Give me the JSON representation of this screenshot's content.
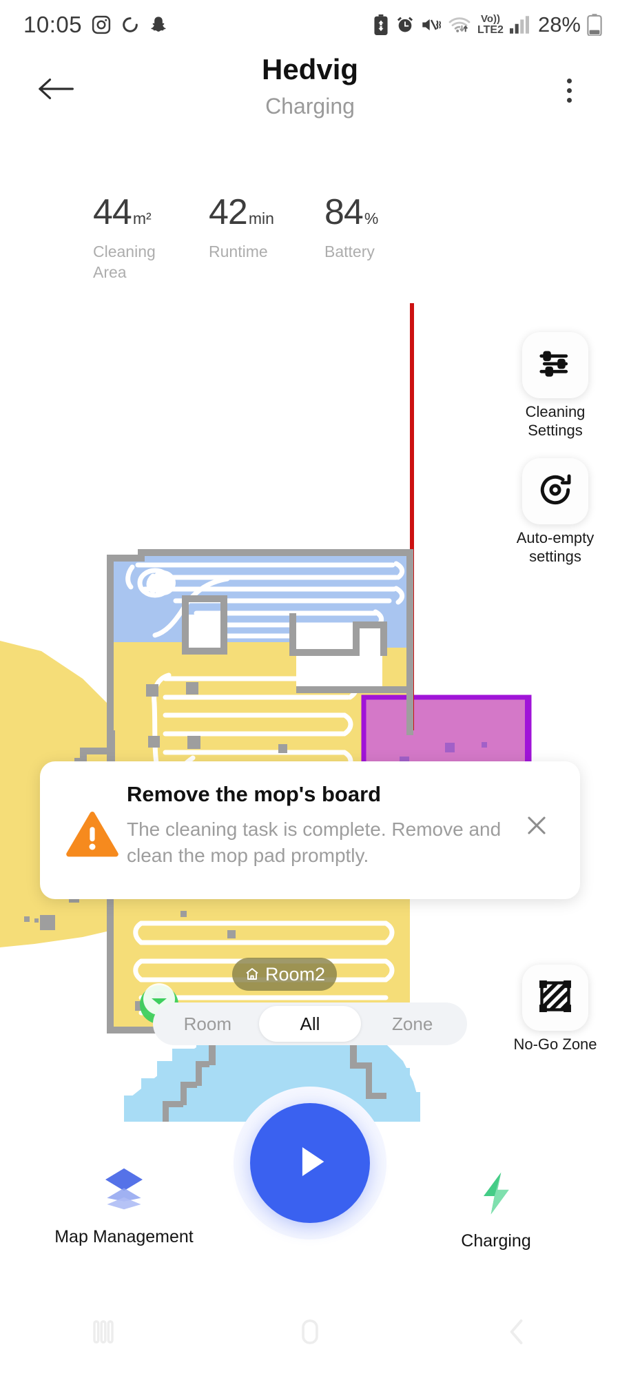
{
  "status_bar": {
    "time": "10:05",
    "left_icons": [
      "instagram-icon",
      "sync-icon",
      "snapchat-icon"
    ],
    "right_icons": [
      "battery-saver-icon",
      "alarm-icon",
      "mute-vibrate-icon",
      "wifi-icon",
      "volte-icon",
      "signal-icon"
    ],
    "volte_top": "Vo))",
    "volte_bottom": "LTE2",
    "battery_percent": "28%"
  },
  "header": {
    "back_icon": "arrow-left-icon",
    "title": "Hedvig",
    "subtitle": "Charging",
    "menu_icon": "more-vertical-icon"
  },
  "stats": [
    {
      "value": "44",
      "unit": "m²",
      "label": "Cleaning Area"
    },
    {
      "value": "42",
      "unit": "min",
      "label": "Runtime"
    },
    {
      "value": "84",
      "unit": "%",
      "label": "Battery"
    }
  ],
  "map": {
    "room_label": "Room2",
    "room_label_icon": "home-icon",
    "colors": {
      "room_blue": "#a9c5f0",
      "room_yellow": "#f5dd78",
      "zone_purple": "#d478c8",
      "zone_purple_border": "#a014d8",
      "room_lightblue": "#a8dcf5",
      "wall_gray": "#9e9e9e",
      "path_white": "#ffffff",
      "virtual_wall_red": "#cc1111",
      "dock_green": "#3ecf5e"
    }
  },
  "side_buttons": [
    {
      "id": "cleaning-settings",
      "icon": "sliders-icon",
      "label": "Cleaning Settings"
    },
    {
      "id": "auto-empty",
      "icon": "auto-empty-icon",
      "label": "Auto-empty settings"
    },
    {
      "id": "no-go-zone",
      "icon": "no-go-zone-icon",
      "label": "No-Go Zone"
    }
  ],
  "notice": {
    "icon": "warning-triangle-icon",
    "title": "Remove the mop's board",
    "text": "The cleaning task is complete. Remove and clean the mop pad promptly.",
    "close_icon": "close-icon",
    "accent": "#f68a1e"
  },
  "segmented_control": {
    "options": [
      "Room",
      "All",
      "Zone"
    ],
    "selected": "All"
  },
  "fab": {
    "icon": "play-icon",
    "color": "#3a61f0"
  },
  "bottom_bar": [
    {
      "id": "map-management",
      "icon": "layers-icon",
      "label": "Map Management",
      "color": "#5572e8"
    },
    {
      "id": "charging",
      "icon": "bolt-icon",
      "label": "Charging",
      "color": "#44cc86"
    }
  ],
  "nav_bar": {
    "recents_icon": "recents-icon",
    "home_icon": "home-square-icon",
    "back_icon": "chevron-left-icon"
  }
}
